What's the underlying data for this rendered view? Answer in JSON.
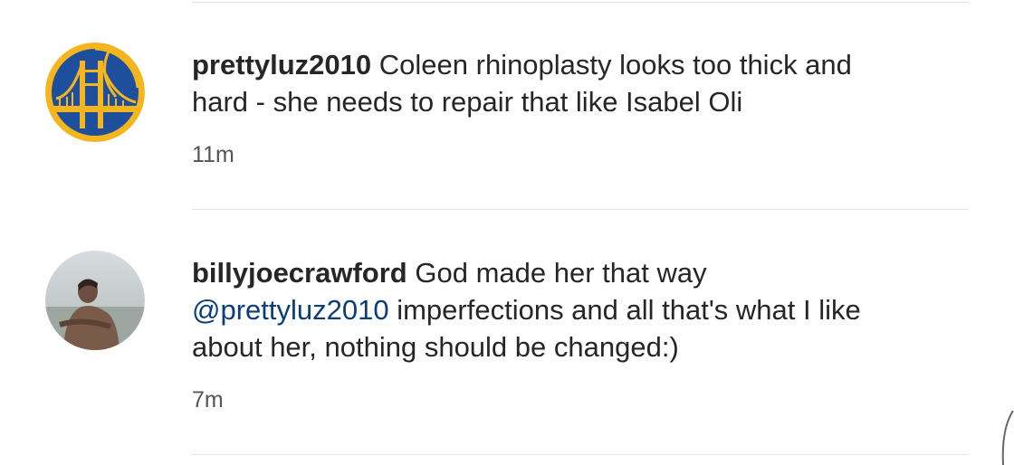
{
  "comments": [
    {
      "username": "prettyluz2010",
      "text": "Coleen rhinoplasty looks too thick and hard - she needs to repair that like Isabel Oli",
      "time": "11m",
      "avatar_icon": "golden-state-warriors-logo",
      "avatar_colors": {
        "ring": "#F5B51E",
        "field": "#1D4F9C"
      }
    },
    {
      "username": "billyjoecrawford",
      "text_before": "God made her that way",
      "mention": "@prettyluz2010",
      "text_after": "imperfections and all that's what I like about her, nothing should be changed:)",
      "time": "7m",
      "avatar_icon": "profile-photo-person"
    }
  ],
  "colors": {
    "text": "#262626",
    "mention": "#0A3D7A",
    "timestamp": "#555555",
    "divider": "#E4E4E4"
  }
}
